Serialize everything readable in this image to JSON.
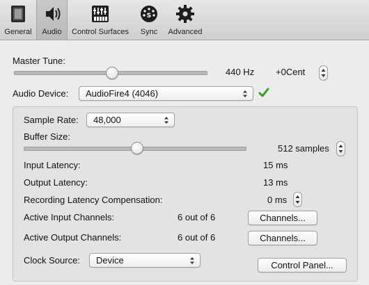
{
  "toolbar": {
    "items": [
      {
        "label": "General",
        "icon": "general-panel-icon"
      },
      {
        "label": "Audio",
        "icon": "speaker-icon",
        "selected": true
      },
      {
        "label": "Control Surfaces",
        "icon": "control-surface-icon"
      },
      {
        "label": "Sync",
        "icon": "sync-icon"
      },
      {
        "label": "Advanced",
        "icon": "gear-icon"
      }
    ]
  },
  "master_tune": {
    "label": "Master Tune:",
    "hz_value": "440 Hz",
    "cent_value": "+0Cent",
    "slider_fraction": 0.5
  },
  "audio_device": {
    "label": "Audio Device:",
    "value": "AudioFire4 (4046)",
    "status_icon": "checkmark-icon",
    "status_color": "#3a9b2a"
  },
  "sample_rate": {
    "label": "Sample Rate:",
    "value": "48,000"
  },
  "buffer_size": {
    "label": "Buffer Size:",
    "value": "512 samples",
    "slider_fraction": 0.5
  },
  "input_latency": {
    "label": "Input Latency:",
    "value": "15 ms"
  },
  "output_latency": {
    "label": "Output Latency:",
    "value": "13 ms"
  },
  "recording_latency": {
    "label": "Recording Latency Compensation:",
    "value": "0 ms"
  },
  "active_input": {
    "label": "Active Input Channels:",
    "value": "6 out of 6",
    "button": "Channels..."
  },
  "active_output": {
    "label": "Active Output Channels:",
    "value": "6 out of 6",
    "button": "Channels..."
  },
  "clock_source": {
    "label": "Clock Source:",
    "value": "Device",
    "button": "Control Panel..."
  }
}
